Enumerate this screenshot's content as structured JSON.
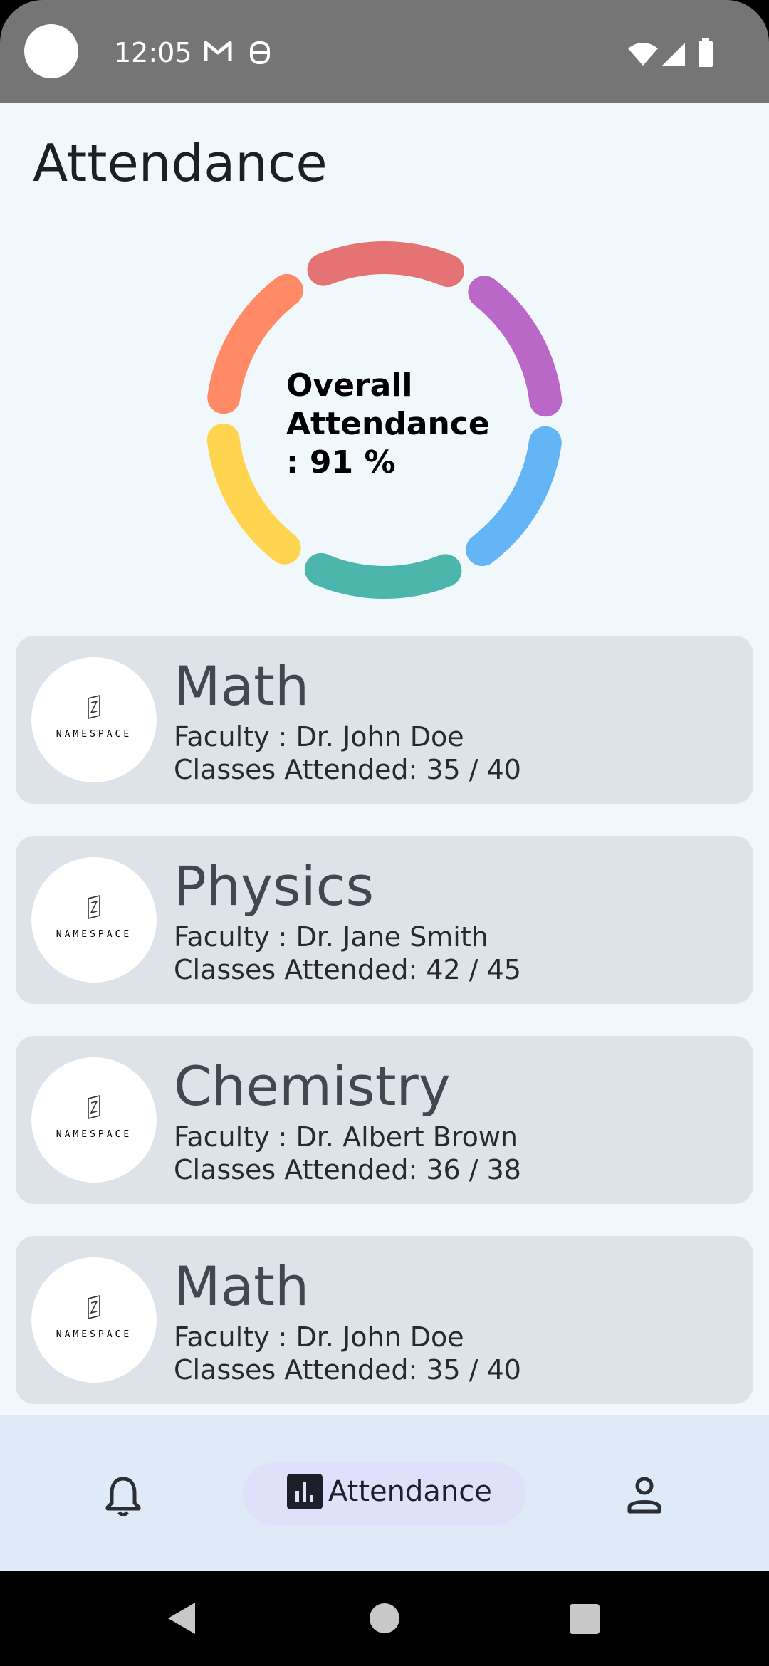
{
  "status_bar": {
    "time": "12:05",
    "icons": [
      "gmail-icon",
      "notification-icon",
      "wifi-icon",
      "signal-icon",
      "battery-icon"
    ]
  },
  "page": {
    "title": "Attendance"
  },
  "overall": {
    "line1": "Overall",
    "line2": "Attendance",
    "line3": ": 91 %",
    "segment_colors": [
      "#FF8A65",
      "#E57373",
      "#BA68C8",
      "#64B5F6",
      "#4DB6AC",
      "#FFD54F"
    ]
  },
  "logo_text": "NAMESPACE",
  "courses": [
    {
      "name": "Math",
      "faculty": "Faculty : Dr. John Doe",
      "classes": "Classes Attended: 35 / 40"
    },
    {
      "name": "Physics",
      "faculty": "Faculty : Dr. Jane Smith",
      "classes": "Classes Attended: 42 / 45"
    },
    {
      "name": "Chemistry",
      "faculty": "Faculty : Dr. Albert Brown",
      "classes": "Classes Attended: 36 / 38"
    },
    {
      "name": "Math",
      "faculty": "Faculty : Dr. John Doe",
      "classes": "Classes Attended: 35 / 40"
    }
  ],
  "bottom_nav": {
    "items": [
      {
        "icon": "bell-icon"
      },
      {
        "icon": "bar-chart-icon",
        "label": "Attendance"
      },
      {
        "icon": "profile-icon"
      }
    ]
  },
  "colors": {
    "background": "#F1F8FC",
    "card": "#DDE3E9",
    "nav_bar": "#DFEAF8",
    "nav_active_pill": "#E0E0FB"
  }
}
